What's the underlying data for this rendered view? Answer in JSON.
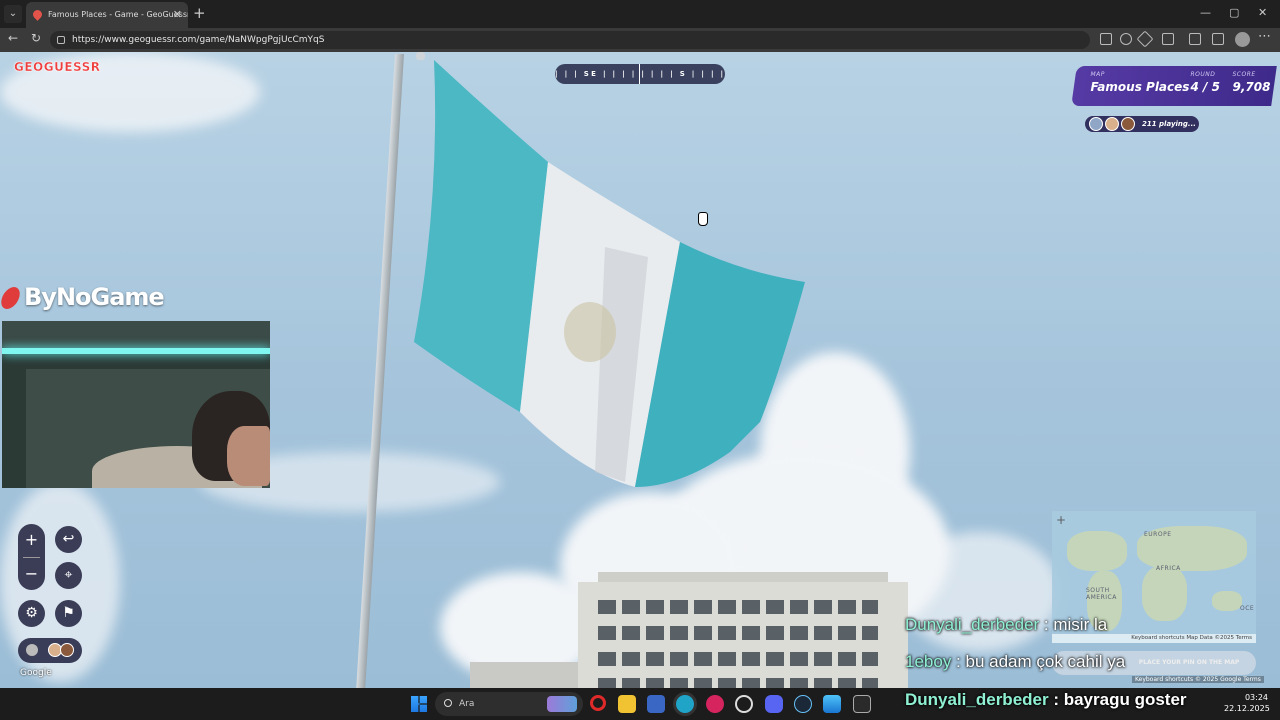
{
  "browser": {
    "tab_title": "Famous Places - Game - GeoGuessr",
    "close_tab": "✕",
    "new_tab": "+",
    "tab_list": "⌄",
    "url": "https://www.geoguessr.com/game/NaNWpgPgjUcCmYqS",
    "back": "←",
    "reload": "↻",
    "minimize": "—",
    "maximize": "▢",
    "close_window": "✕",
    "menu": "⋯"
  },
  "game": {
    "logo": "GEOGUESSR",
    "compass_text": "| | |  SE  | | | | | | | |  S  | | | | | | | |",
    "map_label": "MAP",
    "map_value": "Famous Places",
    "round_label": "ROUND",
    "round_value": "4 / 5",
    "score_label": "SCORE",
    "score_value": "9,708",
    "players_text": "211 playing...",
    "zoom_in": "+",
    "zoom_out": "−",
    "undo_icon": "↩",
    "pin_icon": "⌖",
    "settings_icon": "⚙",
    "flag_icon": "⚑",
    "google_watermark": "Google",
    "minimap": {
      "zoom": "+",
      "labels": [
        "EUROPE",
        "AFRICA",
        "SOUTH AMERICA",
        "OCE"
      ],
      "footer": "Keyboard shortcuts   Map Data ©2025   Terms"
    },
    "map_footer": "Keyboard shortcuts  © 2025 Google  Terms",
    "guess_text": "PLACE YOUR PIN ON THE MAP"
  },
  "stream": {
    "channel_logo": "ByNoGame",
    "chat": [
      {
        "user": "Dunyali_derbeder",
        "message": " : misir la"
      },
      {
        "user": "1eboy",
        "message": " : bu adam çok cahil ya"
      },
      {
        "user": "Dunyali_derbeder",
        "message": " : bayragu goster"
      }
    ]
  },
  "taskbar": {
    "search_placeholder": "Ara",
    "time": "03:24",
    "date": "22.12.2025"
  },
  "colors": {
    "flag_blue": "#4bb8c4",
    "flag_white": "#e8ecef",
    "geoguessr_purple": "#563aa5",
    "chat_username": "#8ff0d2"
  }
}
